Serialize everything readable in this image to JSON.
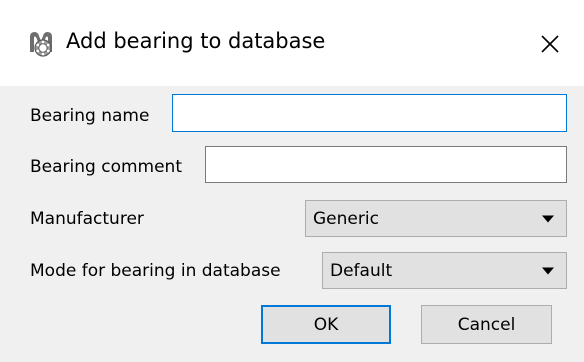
{
  "window": {
    "title": "Add bearing to database",
    "icon": "bearing-app-icon",
    "close_icon": "close-icon"
  },
  "form": {
    "bearing_name": {
      "label": "Bearing name",
      "value": ""
    },
    "bearing_comment": {
      "label": "Bearing comment",
      "value": ""
    },
    "manufacturer": {
      "label": "Manufacturer",
      "selected": "Generic"
    },
    "mode": {
      "label": "Mode for bearing in database",
      "selected": "Default"
    }
  },
  "buttons": {
    "ok_label": "OK",
    "cancel_label": "Cancel"
  },
  "colors": {
    "accent": "#0078d7",
    "panel_bg": "#f0f0f0",
    "button_bg": "#e1e1e1"
  }
}
